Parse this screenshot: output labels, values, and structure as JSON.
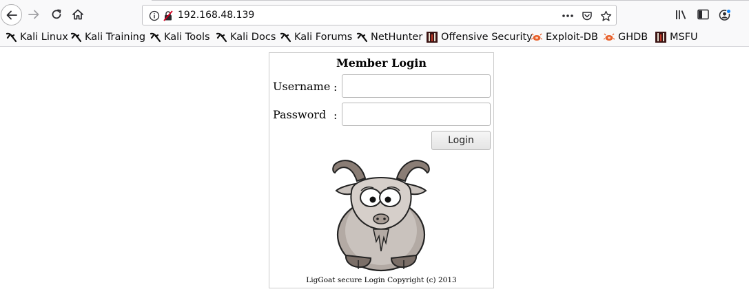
{
  "browser": {
    "url": "192.168.48.139",
    "icons": {
      "back": "back-arrow-icon",
      "forward": "forward-arrow-icon",
      "reload": "reload-icon",
      "home": "home-icon",
      "info": "info-icon",
      "insecure": "insecure-lock-icon",
      "page_actions": "more-dots-icon",
      "pocket": "pocket-icon",
      "bookmark_star": "star-icon",
      "library": "library-icon",
      "sidebar": "sidebar-icon",
      "account": "account-icon"
    },
    "bookmarks": [
      {
        "label": "Kali Linux",
        "icon": "kali-dragon-icon"
      },
      {
        "label": "Kali Training",
        "icon": "kali-dragon-icon"
      },
      {
        "label": "Kali Tools",
        "icon": "kali-dragon-icon"
      },
      {
        "label": "Kali Docs",
        "icon": "kali-dragon-icon"
      },
      {
        "label": "Kali Forums",
        "icon": "kali-dragon-icon"
      },
      {
        "label": "NetHunter",
        "icon": "kali-dragon-icon"
      },
      {
        "label": "Offensive Security",
        "icon": "offsec-icon"
      },
      {
        "label": "Exploit-DB",
        "icon": "exploitdb-bug-icon"
      },
      {
        "label": "GHDB",
        "icon": "exploitdb-bug-icon"
      },
      {
        "label": "MSFU",
        "icon": "offsec-icon"
      }
    ]
  },
  "login": {
    "title": "Member Login",
    "username_label": "Username",
    "password_label": "Password",
    "colon": ":",
    "username_value": "",
    "password_value": "",
    "button_label": "Login",
    "mascot": "goat-mascot-icon",
    "copyright": "LigGoat secure Login Copyright (c) 2013"
  },
  "colors": {
    "chrome_bg": "#f9f9fa",
    "account_badge": "#0a84ff",
    "goat_body": "#c9c2bd",
    "goat_horns": "#8a7d75"
  }
}
